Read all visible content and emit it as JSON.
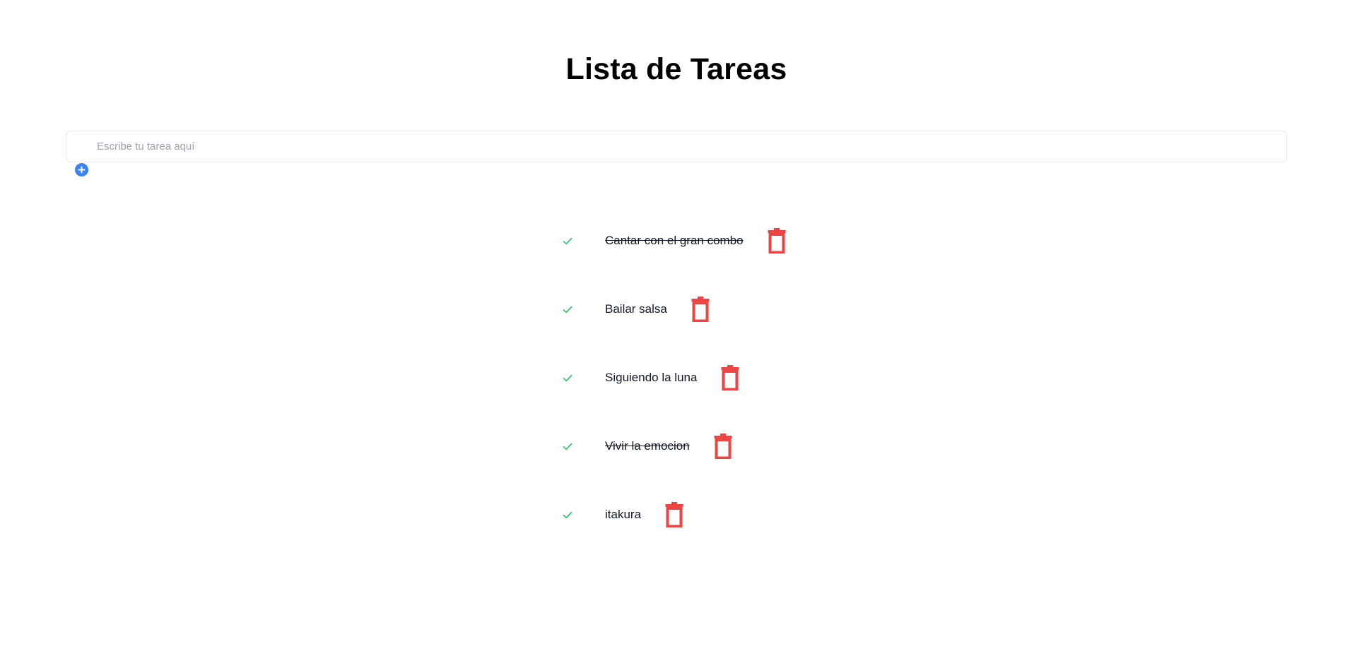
{
  "header": {
    "title": "Lista de Tareas"
  },
  "new_task": {
    "placeholder": "Escribe tu tarea aquí",
    "value": "",
    "add_icon": "plus-circle-icon"
  },
  "tasks": [
    {
      "text": "Cantar con el gran combo",
      "completed": true
    },
    {
      "text": "Bailar salsa",
      "completed": false
    },
    {
      "text": "Siguiendo la luna",
      "completed": false
    },
    {
      "text": "Vivir la emocion",
      "completed": true
    },
    {
      "text": "itakura",
      "completed": false
    }
  ],
  "icons": {
    "check": "check-icon",
    "delete": "trash-icon"
  },
  "colors": {
    "accent": "#3b82f6",
    "check": "#22c55e",
    "delete": "#ef4444",
    "text": "#111827",
    "input_border": "#e5e7eb",
    "placeholder": "#9ca3af"
  }
}
